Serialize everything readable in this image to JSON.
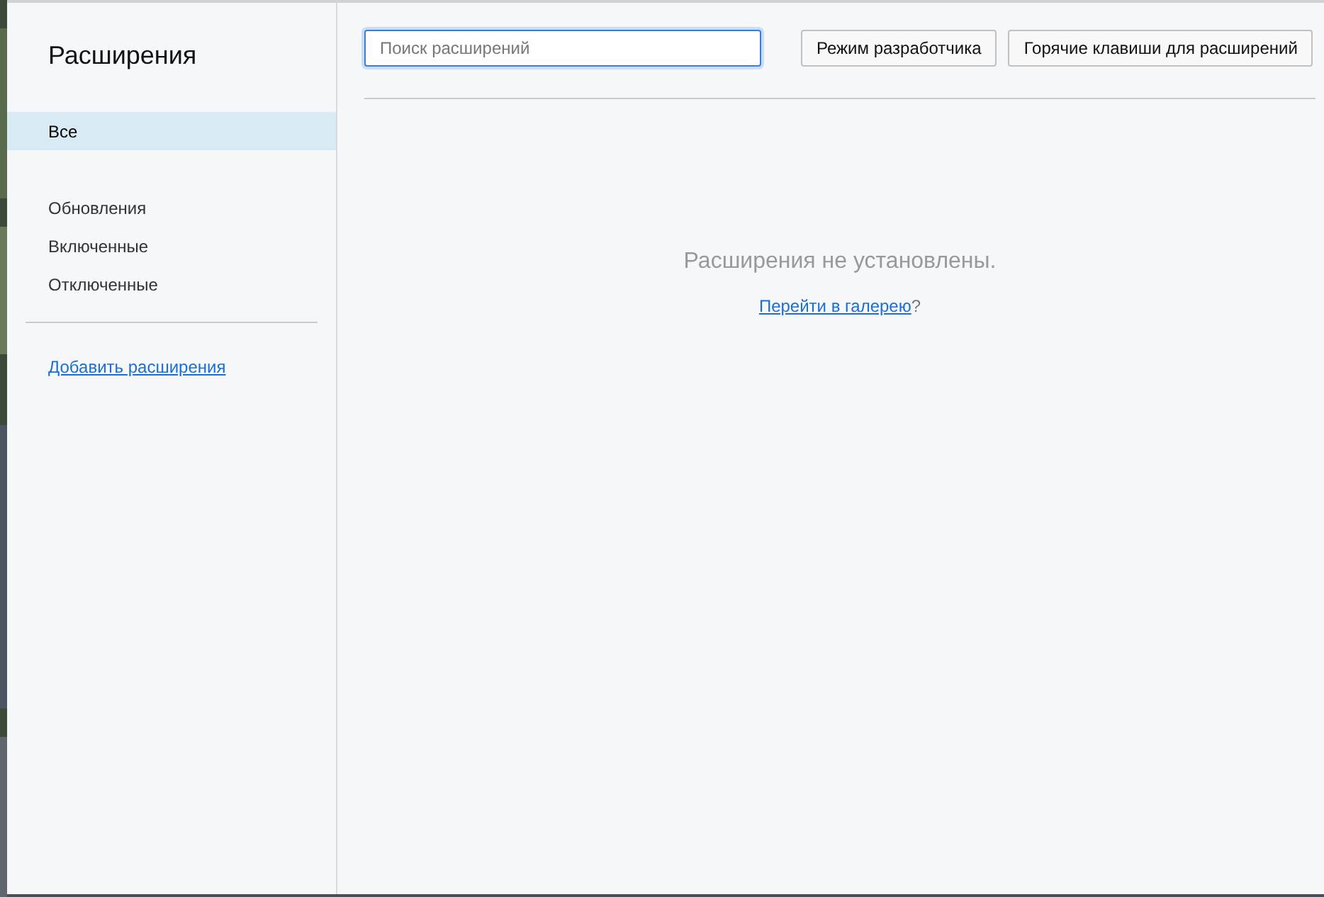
{
  "sidebar": {
    "title": "Расширения",
    "items": [
      {
        "label": "Все",
        "selected": true
      },
      {
        "label": "Обновления",
        "selected": false
      },
      {
        "label": "Включенные",
        "selected": false
      },
      {
        "label": "Отключенные",
        "selected": false
      }
    ],
    "link": "Добавить расширения"
  },
  "toolbar": {
    "search": {
      "placeholder": "Поиск расширений"
    },
    "buttons": [
      "Режим разработчика",
      "Горячие клавиши для расширений"
    ]
  },
  "empty": {
    "message": "Расширения не установлены.",
    "link": "Перейти в галерею",
    "suffix": "?"
  }
}
